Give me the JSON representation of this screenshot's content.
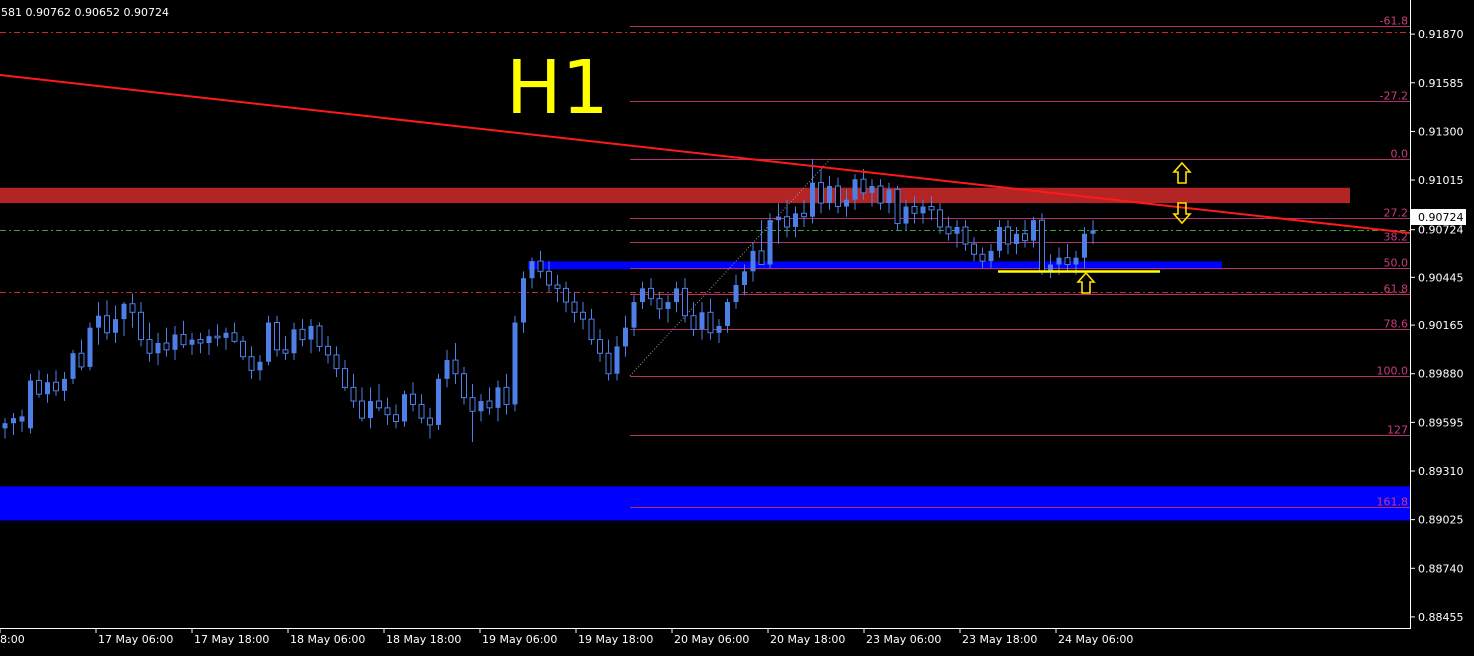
{
  "header": {
    "ohlc_text": "581 0.90762 0.90652 0.90724"
  },
  "timeframe_label": "H1",
  "colors": {
    "background": "#000000",
    "axis": "#ffffff",
    "candle": "#4d7fe6",
    "trendline": "#ff1a1a",
    "resistance_zone": "#b32424",
    "support_zone": "#0000ff",
    "fib": "#b4306a",
    "fib_text": "#c73b7e",
    "dashed_red": "#c22c2c",
    "dashed_green": "#33aa33",
    "arrow": "#ffe200",
    "yellow_line": "#ffff00",
    "label_text": "#ffff00"
  },
  "chart_data": {
    "type": "candlestick",
    "title": "H1",
    "y_axis": {
      "ylim": [
        0.8839,
        0.9207
      ],
      "tick_labels": [
        "0.91870",
        "0.91585",
        "0.91300",
        "0.91015",
        "0.90724",
        "0.90445",
        "0.90165",
        "0.89880",
        "0.89595",
        "0.89310",
        "0.89025",
        "0.88740",
        "0.88455"
      ],
      "current_price": "0.90724"
    },
    "x_axis": {
      "tick_labels": [
        "8:00",
        "17 May 06:00",
        "17 May 18:00",
        "18 May 06:00",
        "18 May 18:00",
        "19 May 06:00",
        "19 May 18:00",
        "20 May 06:00",
        "20 May 18:00",
        "23 May 06:00",
        "23 May 18:00",
        "24 May 06:00"
      ]
    },
    "fib_levels": [
      {
        "label": "-61.8",
        "price": 0.9192
      },
      {
        "label": "-27.2",
        "price": 0.9148
      },
      {
        "label": "0.0",
        "price": 0.91136
      },
      {
        "label": "27.2",
        "price": 0.9079
      },
      {
        "label": "38.2",
        "price": 0.9065
      },
      {
        "label": "50.0",
        "price": 0.90501
      },
      {
        "label": "61.8",
        "price": 0.9035
      },
      {
        "label": "78.6",
        "price": 0.9014
      },
      {
        "label": "100.0",
        "price": 0.89868
      },
      {
        "label": "127",
        "price": 0.8952
      },
      {
        "label": "161.8",
        "price": 0.891
      }
    ],
    "zones": [
      {
        "name": "resistance",
        "price_top": 0.9097,
        "price_bottom": 0.9088
      },
      {
        "name": "middle-support",
        "price_top": 0.90538,
        "price_bottom": 0.90492
      },
      {
        "name": "lower-support",
        "price_top": 0.8922,
        "price_bottom": 0.8902
      }
    ],
    "candles": [
      [
        0.8956,
        0.8962,
        0.895,
        0.8959
      ],
      [
        0.8959,
        0.8965,
        0.8952,
        0.8962
      ],
      [
        0.896,
        0.8967,
        0.8954,
        0.8963
      ],
      [
        0.8956,
        0.8988,
        0.8953,
        0.8984
      ],
      [
        0.8984,
        0.899,
        0.8974,
        0.8976
      ],
      [
        0.8976,
        0.8988,
        0.8971,
        0.8983
      ],
      [
        0.8983,
        0.899,
        0.8975,
        0.8978
      ],
      [
        0.8978,
        0.8989,
        0.8972,
        0.8985
      ],
      [
        0.8985,
        0.9002,
        0.8982,
        0.9
      ],
      [
        0.9,
        0.9008,
        0.899,
        0.8992
      ],
      [
        0.8992,
        0.9018,
        0.899,
        0.9015
      ],
      [
        0.9015,
        0.903,
        0.9005,
        0.9022
      ],
      [
        0.9022,
        0.9031,
        0.9008,
        0.9012
      ],
      [
        0.9012,
        0.9028,
        0.9006,
        0.902
      ],
      [
        0.902,
        0.903,
        0.901,
        0.9029
      ],
      [
        0.9029,
        0.9035,
        0.9015,
        0.9024
      ],
      [
        0.9024,
        0.903,
        0.9004,
        0.9008
      ],
      [
        0.9008,
        0.9018,
        0.8995,
        0.9
      ],
      [
        0.9,
        0.9012,
        0.8993,
        0.9006
      ],
      [
        0.9006,
        0.9015,
        0.8998,
        0.9002
      ],
      [
        0.9002,
        0.9016,
        0.8996,
        0.9011
      ],
      [
        0.9011,
        0.9019,
        0.9003,
        0.9005
      ],
      [
        0.9005,
        0.9012,
        0.8999,
        0.9008
      ],
      [
        0.9008,
        0.9012,
        0.9,
        0.9006
      ],
      [
        0.9006,
        0.9014,
        0.8999,
        0.901
      ],
      [
        0.901,
        0.9017,
        0.9004,
        0.9009
      ],
      [
        0.9009,
        0.9015,
        0.9002,
        0.9012
      ],
      [
        0.9012,
        0.9018,
        0.9006,
        0.9007
      ],
      [
        0.9007,
        0.901,
        0.8996,
        0.8998
      ],
      [
        0.8998,
        0.9004,
        0.8985,
        0.899
      ],
      [
        0.899,
        0.8999,
        0.8984,
        0.8995
      ],
      [
        0.8995,
        0.9022,
        0.8993,
        0.9018
      ],
      [
        0.9018,
        0.9022,
        0.8998,
        0.9002
      ],
      [
        0.9002,
        0.901,
        0.8996,
        0.9
      ],
      [
        0.9,
        0.9018,
        0.8996,
        0.9014
      ],
      [
        0.9014,
        0.902,
        0.9004,
        0.9008
      ],
      [
        0.9008,
        0.902,
        0.9,
        0.9016
      ],
      [
        0.9016,
        0.9018,
        0.9001,
        0.9004
      ],
      [
        0.9004,
        0.901,
        0.8994,
        0.8999
      ],
      [
        0.8999,
        0.9004,
        0.8986,
        0.8991
      ],
      [
        0.8991,
        0.8996,
        0.8978,
        0.898
      ],
      [
        0.898,
        0.8988,
        0.8968,
        0.8972
      ],
      [
        0.8972,
        0.898,
        0.896,
        0.8962
      ],
      [
        0.8962,
        0.898,
        0.8956,
        0.8972
      ],
      [
        0.8972,
        0.8982,
        0.8966,
        0.8968
      ],
      [
        0.8968,
        0.8974,
        0.8958,
        0.8964
      ],
      [
        0.8964,
        0.897,
        0.8956,
        0.896
      ],
      [
        0.896,
        0.8978,
        0.8957,
        0.8976
      ],
      [
        0.8976,
        0.8983,
        0.8966,
        0.897
      ],
      [
        0.897,
        0.8976,
        0.8959,
        0.8962
      ],
      [
        0.8962,
        0.8968,
        0.895,
        0.8958
      ],
      [
        0.8958,
        0.8988,
        0.8955,
        0.8985
      ],
      [
        0.8985,
        0.9002,
        0.898,
        0.8996
      ],
      [
        0.8996,
        0.9006,
        0.8982,
        0.8988
      ],
      [
        0.8988,
        0.8992,
        0.897,
        0.8974
      ],
      [
        0.8974,
        0.8982,
        0.8948,
        0.8966
      ],
      [
        0.8966,
        0.8976,
        0.896,
        0.8972
      ],
      [
        0.8972,
        0.898,
        0.8964,
        0.8968
      ],
      [
        0.8968,
        0.8984,
        0.896,
        0.898
      ],
      [
        0.898,
        0.8988,
        0.8964,
        0.897
      ],
      [
        0.897,
        0.9022,
        0.8966,
        0.9018
      ],
      [
        0.9018,
        0.9048,
        0.9012,
        0.9044
      ],
      [
        0.9044,
        0.9056,
        0.9038,
        0.9054
      ],
      [
        0.9054,
        0.906,
        0.9044,
        0.9048
      ],
      [
        0.9048,
        0.9054,
        0.9036,
        0.904
      ],
      [
        0.904,
        0.9046,
        0.903,
        0.9038
      ],
      [
        0.9038,
        0.9042,
        0.9024,
        0.903
      ],
      [
        0.903,
        0.9036,
        0.9018,
        0.9024
      ],
      [
        0.9024,
        0.903,
        0.9014,
        0.902
      ],
      [
        0.902,
        0.9026,
        0.9005,
        0.9008
      ],
      [
        0.9008,
        0.9014,
        0.8995,
        0.9
      ],
      [
        0.9,
        0.9008,
        0.8984,
        0.8988
      ],
      [
        0.8988,
        0.901,
        0.8984,
        0.9004
      ],
      [
        0.9004,
        0.9022,
        0.8998,
        0.9015
      ],
      [
        0.9015,
        0.9034,
        0.901,
        0.903
      ],
      [
        0.903,
        0.9042,
        0.9026,
        0.9038
      ],
      [
        0.9038,
        0.9044,
        0.9028,
        0.9032
      ],
      [
        0.9032,
        0.9036,
        0.902,
        0.9026
      ],
      [
        0.9026,
        0.9034,
        0.9018,
        0.903
      ],
      [
        0.903,
        0.9042,
        0.9024,
        0.9038
      ],
      [
        0.9038,
        0.9044,
        0.9018,
        0.9022
      ],
      [
        0.9022,
        0.903,
        0.901,
        0.9014
      ],
      [
        0.9014,
        0.903,
        0.9008,
        0.9024
      ],
      [
        0.9024,
        0.9032,
        0.9008,
        0.9012
      ],
      [
        0.9012,
        0.902,
        0.9006,
        0.9016
      ],
      [
        0.9016,
        0.9032,
        0.9012,
        0.903
      ],
      [
        0.903,
        0.9046,
        0.9026,
        0.904
      ],
      [
        0.904,
        0.9052,
        0.9034,
        0.9048
      ],
      [
        0.9048,
        0.9065,
        0.9042,
        0.906
      ],
      [
        0.906,
        0.9078,
        0.9054,
        0.9052
      ],
      [
        0.9052,
        0.9082,
        0.905,
        0.9078
      ],
      [
        0.9078,
        0.9088,
        0.9064,
        0.908
      ],
      [
        0.908,
        0.909,
        0.9068,
        0.9074
      ],
      [
        0.9074,
        0.9086,
        0.9068,
        0.9082
      ],
      [
        0.9082,
        0.909,
        0.9074,
        0.908
      ],
      [
        0.908,
        0.9114,
        0.9076,
        0.91
      ],
      [
        0.91,
        0.9108,
        0.9082,
        0.9088
      ],
      [
        0.9088,
        0.9104,
        0.9084,
        0.9098
      ],
      [
        0.9098,
        0.9103,
        0.9082,
        0.9086
      ],
      [
        0.9086,
        0.9096,
        0.908,
        0.909
      ],
      [
        0.909,
        0.9105,
        0.9084,
        0.9102
      ],
      [
        0.9102,
        0.9108,
        0.909,
        0.9094
      ],
      [
        0.9094,
        0.9102,
        0.9086,
        0.9098
      ],
      [
        0.9098,
        0.9102,
        0.9084,
        0.9088
      ],
      [
        0.9088,
        0.91,
        0.9082,
        0.9096
      ],
      [
        0.9096,
        0.9098,
        0.9072,
        0.9076
      ],
      [
        0.9076,
        0.909,
        0.9072,
        0.9086
      ],
      [
        0.9086,
        0.9092,
        0.9076,
        0.9082
      ],
      [
        0.9082,
        0.909,
        0.9076,
        0.9086
      ],
      [
        0.9086,
        0.9092,
        0.9078,
        0.9084
      ],
      [
        0.9084,
        0.9088,
        0.907,
        0.9074
      ],
      [
        0.9074,
        0.908,
        0.9066,
        0.907
      ],
      [
        0.907,
        0.9078,
        0.9062,
        0.9074
      ],
      [
        0.9074,
        0.9078,
        0.906,
        0.9064
      ],
      [
        0.9064,
        0.9068,
        0.9054,
        0.9058
      ],
      [
        0.9058,
        0.9062,
        0.905,
        0.9054
      ],
      [
        0.9054,
        0.9064,
        0.905,
        0.906
      ],
      [
        0.906,
        0.9078,
        0.9056,
        0.9074
      ],
      [
        0.9074,
        0.9078,
        0.9058,
        0.9064
      ],
      [
        0.9064,
        0.9074,
        0.9058,
        0.907
      ],
      [
        0.907,
        0.9078,
        0.9062,
        0.9066
      ],
      [
        0.9066,
        0.908,
        0.9062,
        0.9078
      ],
      [
        0.9078,
        0.9082,
        0.9046,
        0.9048
      ],
      [
        0.9048,
        0.9058,
        0.9044,
        0.9052
      ],
      [
        0.9052,
        0.9062,
        0.9046,
        0.9056
      ],
      [
        0.9056,
        0.9064,
        0.9048,
        0.9052
      ],
      [
        0.9052,
        0.906,
        0.9046,
        0.9056
      ],
      [
        0.9056,
        0.9074,
        0.905,
        0.907
      ],
      [
        0.907,
        0.9078,
        0.9064,
        0.9072
      ]
    ]
  }
}
